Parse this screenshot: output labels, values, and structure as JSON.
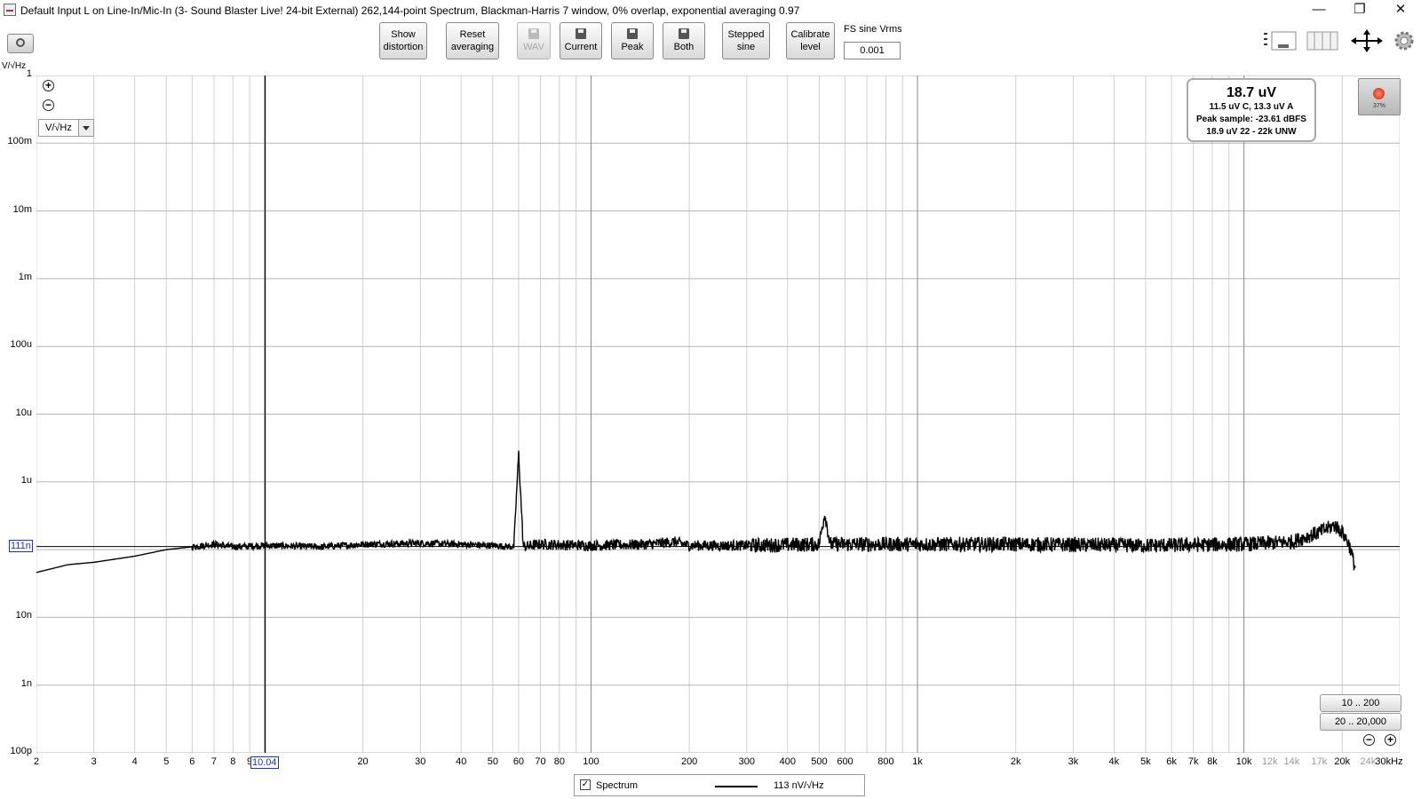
{
  "window": {
    "title": "Default Input L on Line-In/Mic-In (3- Sound Blaster Live! 24-bit External) 262,144-point Spectrum, Blackman-Harris 7 window, 0% overlap, exponential averaging 0.97",
    "minimize": "—",
    "restore": "❐",
    "close": "✕"
  },
  "toolbar": {
    "show_distortion": [
      "Show",
      "distortion"
    ],
    "reset_averaging": [
      "Reset",
      "averaging"
    ],
    "wav": "WAV",
    "current": "Current",
    "peak": "Peak",
    "both": "Both",
    "stepped_sine": [
      "Stepped",
      "sine"
    ],
    "calibrate_level": [
      "Calibrate",
      "level"
    ],
    "fs_sine_label": "FS sine Vrms",
    "fs_sine_value": "0.001"
  },
  "plot": {
    "y_unit_label": "V/√Hz",
    "unit_selector": "V/√Hz",
    "y_cursor_label": "111n",
    "x_cursor_label": "10.04"
  },
  "level_meter": {
    "main": "18.7 uV",
    "line1": "11.5 uV C, 13.3 uV A",
    "line2": "Peak sample: -23.61 dBFS",
    "line3": "18.9 uV 22 - 22k UNW"
  },
  "record_button": {
    "percent": "37%"
  },
  "range_buttons": {
    "r1": "10 .. 200",
    "r2": "20 .. 20,000"
  },
  "legend": {
    "name": "Spectrum",
    "value": "113 nV/√Hz",
    "checked": "✓"
  },
  "chart_data": {
    "type": "line",
    "title": "",
    "xlabel": "",
    "ylabel": "V/√Hz",
    "x_scale": "log",
    "y_scale": "log",
    "xlim": [
      2,
      30000
    ],
    "ylim": [
      1e-10,
      1
    ],
    "y_tick_labels": [
      "1",
      "100m",
      "10m",
      "1m",
      "100u",
      "10u",
      "1u",
      "100n",
      "10n",
      "1n",
      "100p"
    ],
    "x_tick_labels": [
      "2",
      "3",
      "4",
      "5",
      "6",
      "7",
      "8",
      "9",
      "20",
      "30",
      "40",
      "50",
      "60",
      "70",
      "80",
      "100",
      "200",
      "300",
      "400",
      "500",
      "600",
      "800",
      "1k",
      "2k",
      "3k",
      "4k",
      "5k",
      "6k",
      "7k",
      "8k",
      "10k",
      "12k",
      "14k",
      "17k",
      "20k",
      "24k",
      "30kHz"
    ],
    "grid": true,
    "cursor": {
      "x": 10.04,
      "y": 1.11e-07
    },
    "series": [
      {
        "name": "Spectrum",
        "x": [
          2,
          2.5,
          3,
          4,
          5,
          6,
          7,
          8,
          10,
          15,
          20,
          30,
          40,
          50,
          58,
          60,
          62,
          70,
          100,
          150,
          180,
          200,
          300,
          500,
          520,
          540,
          1000,
          2000,
          5000,
          10000,
          14000,
          17000,
          19000,
          20000,
          21000,
          22000
        ],
        "y": [
          4.6e-08,
          6e-08,
          6.5e-08,
          8e-08,
          1e-07,
          1.1e-07,
          1.2e-07,
          1.1e-07,
          1.15e-07,
          1.1e-07,
          1.2e-07,
          1.25e-07,
          1.2e-07,
          1.15e-07,
          1.1e-07,
          2.7e-06,
          1.1e-07,
          1.2e-07,
          1.15e-07,
          1.2e-07,
          1.3e-07,
          1.15e-07,
          1.15e-07,
          1.2e-07,
          3.5e-07,
          1.2e-07,
          1.2e-07,
          1.2e-07,
          1.15e-07,
          1.2e-07,
          1.3e-07,
          1.8e-07,
          2.3e-07,
          1.8e-07,
          1.2e-07,
          5e-08
        ]
      }
    ]
  }
}
